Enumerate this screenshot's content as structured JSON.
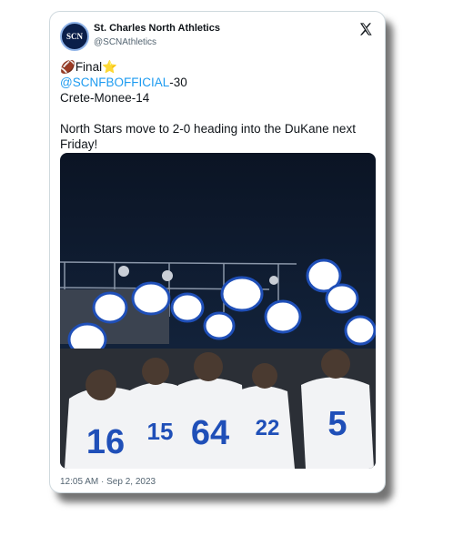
{
  "account": {
    "avatar_text": "SCN",
    "name": "St. Charles North Athletics",
    "handle": "@SCNAthletics"
  },
  "header": {
    "close_icon": "x-logo-icon"
  },
  "tweet": {
    "line1_prefix_emoji": "🏈",
    "line1_text": "Final",
    "line1_suffix_emoji": "⭐",
    "mention": "@SCNFBOFFICIAL",
    "mention_score": "-30",
    "line3": "Crete-Monee-14",
    "body": "North Stars move to 2-0 heading into the DuKane next",
    "body2": "Friday!"
  },
  "photo": {
    "description_icon": "team-photo-image",
    "jersey_numbers": [
      "16",
      "15",
      "64",
      "22",
      "5"
    ]
  },
  "footer": {
    "timestamp": "12:05 AM · Sep 2, 2023"
  },
  "colors": {
    "mention": "#1d9bf0",
    "jersey_blue": "#1f4fb8",
    "sky": "#0f1a2b"
  }
}
